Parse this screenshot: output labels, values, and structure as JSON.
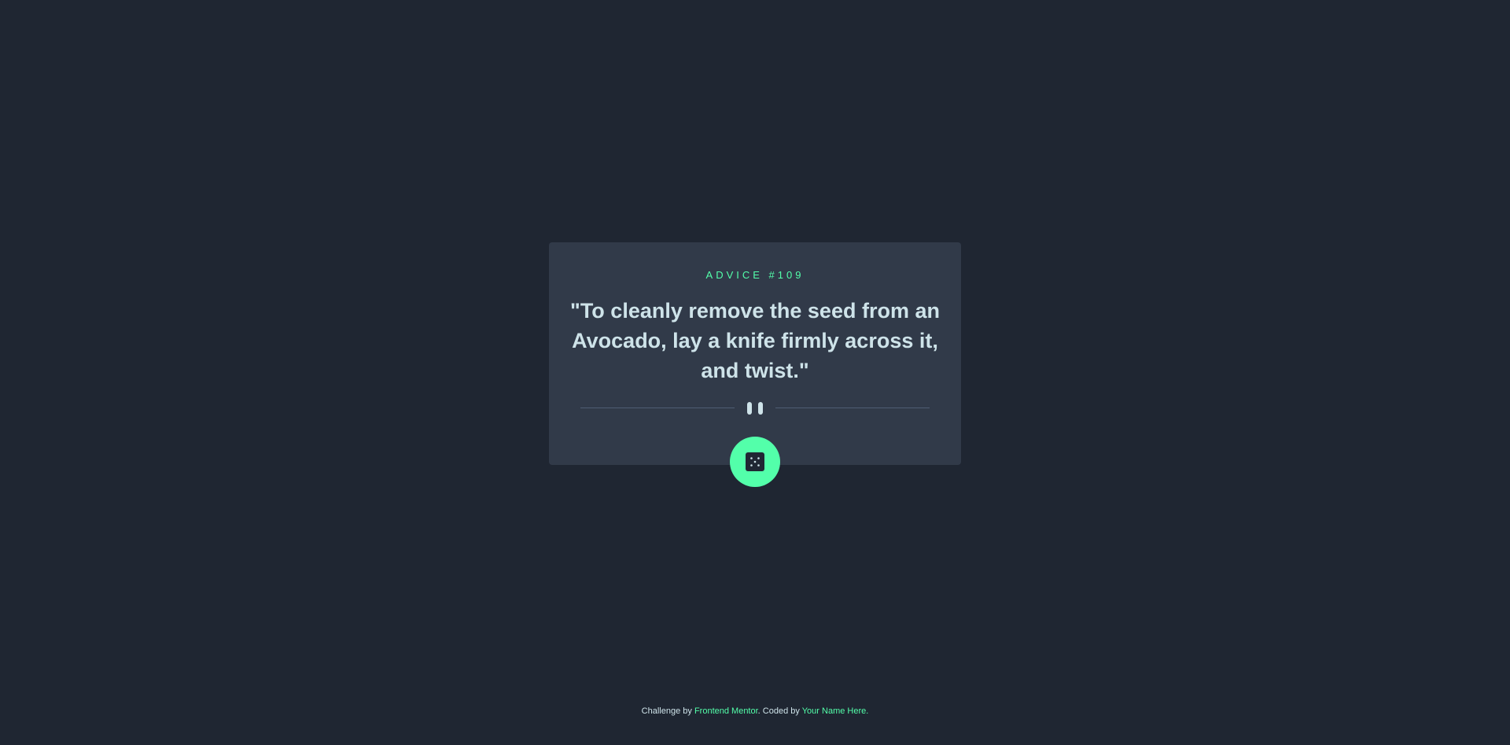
{
  "advice": {
    "id_label": "ADVICE #109",
    "quote": "\"To cleanly remove the seed from an Avocado, lay a knife firmly across it, and twist.\""
  },
  "icons": {
    "divider": "pause-icon",
    "button": "dice-icon"
  },
  "colors": {
    "background": "#1f2632",
    "card": "#313a49",
    "accent": "#53ffaa",
    "text": "#cee3e9",
    "divider": "#4f5d74"
  },
  "footer": {
    "prefix": "Challenge by ",
    "challenge_link": "Frontend Mentor",
    "middle": ". Coded by ",
    "author_link": "Your Name Here",
    "suffix": "."
  }
}
